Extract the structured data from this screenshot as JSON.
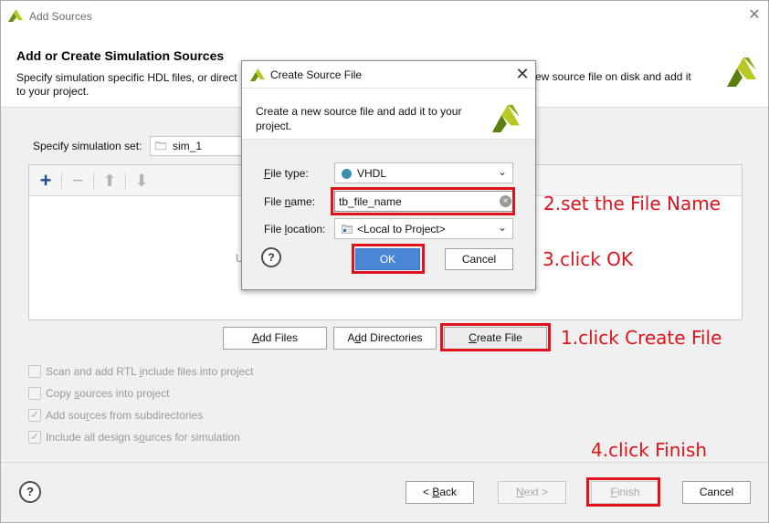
{
  "window": {
    "title": "Add Sources",
    "heading": "Add or Create Simulation Sources",
    "description_left": "Specify simulation specific HDL files, or direct",
    "description_right": "ew source file on disk and add it",
    "description_line2": "to your project."
  },
  "sim_set": {
    "label": "Specify simulation set:",
    "value": "sim_1"
  },
  "file_list": {
    "hint": "U"
  },
  "buttons": {
    "add_files_pre": "",
    "add_files_u": "A",
    "add_files_post": "dd Files",
    "add_dirs_pre": "A",
    "add_dirs_u": "d",
    "add_dirs_post": "d Directories",
    "create_file_pre": "",
    "create_file_u": "C",
    "create_file_post": "reate File"
  },
  "options": [
    {
      "pre": "Scan and add RTL ",
      "u": "i",
      "post": "nclude files into project",
      "checked": false
    },
    {
      "pre": "Copy ",
      "u": "s",
      "post": "ources into project",
      "checked": false
    },
    {
      "pre": "Add sou",
      "u": "r",
      "post": "ces from subdirectories",
      "checked": true
    },
    {
      "pre": "Include all design s",
      "u": "o",
      "post": "urces for simulation",
      "checked": true
    }
  ],
  "footer": {
    "help": "?",
    "back_pre": "< ",
    "back_u": "B",
    "back_post": "ack",
    "next_u": "N",
    "next_post": "ext >",
    "finish_u": "F",
    "finish_post": "inish",
    "cancel": "Cancel"
  },
  "dialog": {
    "title": "Create Source File",
    "close": "✕",
    "description": "Create a new source file and add it to your project.",
    "file_type_label_u": "F",
    "file_type_label_post": "ile type:",
    "file_type_value": "VHDL",
    "file_name_label_pre": "File ",
    "file_name_label_u": "n",
    "file_name_label_post": "ame:",
    "file_name_value": "tb_file_name",
    "file_location_label_pre": "File ",
    "file_location_label_u": "l",
    "file_location_label_post": "ocation:",
    "file_location_value": "<Local to Project>",
    "help": "?",
    "ok": "OK",
    "cancel": "Cancel"
  },
  "annotations": {
    "step1": "1.click Create File",
    "step2": "2.set the File Name",
    "step3": "3.click OK",
    "step4": "4.click Finish",
    "color": "#e0131b"
  },
  "icons": {
    "add": "plus-icon",
    "remove": "minus-icon",
    "up": "arrow-up-icon",
    "down": "arrow-down-icon",
    "logo": "vivado-logo-icon"
  }
}
